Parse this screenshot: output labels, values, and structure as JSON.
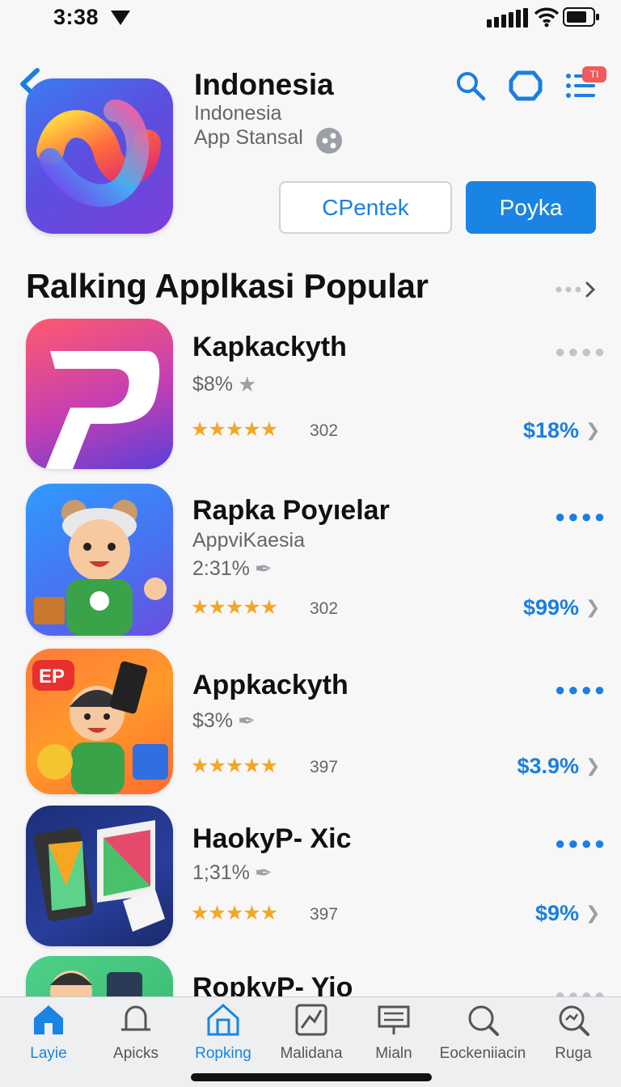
{
  "status": {
    "time": "3:38"
  },
  "header": {
    "title": "Indonesia",
    "subtitle1": "Indonesia",
    "subtitle2": "App Stansal",
    "badge": "TI",
    "btn_outline": "CPentek",
    "btn_primary": "Poyka"
  },
  "section": {
    "title": "Ralking Applkasi Popular"
  },
  "apps": [
    {
      "name": "Kapkackyth",
      "sub": "",
      "meta": "$8%",
      "meta_icon": "star-icon",
      "rating_count": "302",
      "price": "$18%",
      "stars": "★★★★★",
      "rating": 4.5,
      "dots_color": "#c0c4c8"
    },
    {
      "name": "Rapka Poyıelar",
      "sub": "AppviKaesia",
      "meta": "2:31%",
      "meta_icon": "feather-icon",
      "rating_count": "302",
      "price": "$99%",
      "stars": "★★★★★",
      "rating": 4.5,
      "dots_color": "#1a7fe0"
    },
    {
      "name": "Appkackyth",
      "sub": "",
      "meta": "$3%",
      "meta_icon": "feather-icon",
      "rating_count": "397",
      "price": "$3.9%",
      "stars": "★★★★★",
      "rating": 4.5,
      "dots_color": "#1a7fe0"
    },
    {
      "name": "HaokyP- Xic",
      "sub": "",
      "meta": "1;31%",
      "meta_icon": "feather-icon",
      "rating_count": "397",
      "price": "$9%",
      "stars": "★★★★★",
      "rating": 4.5,
      "dots_color": "#1a7fe0"
    },
    {
      "name": "RopkyP- Yio",
      "sub": "",
      "meta": "",
      "meta_icon": "",
      "rating_count": "",
      "price": "",
      "stars": "",
      "rating": 0,
      "dots_color": "#c0c4c8"
    }
  ],
  "tabs": [
    {
      "label": "Layie",
      "icon": "home-icon",
      "active": true
    },
    {
      "label": "Apicks",
      "icon": "bell-icon",
      "active": false
    },
    {
      "label": "Ropking",
      "icon": "house-outline-icon",
      "active": true
    },
    {
      "label": "Malidana",
      "icon": "chart-icon",
      "active": false
    },
    {
      "label": "Mialn",
      "icon": "board-icon",
      "active": false
    },
    {
      "label": "Eockeniiacin",
      "icon": "search-icon",
      "active": false
    },
    {
      "label": "Ruga",
      "icon": "search-zoom-icon",
      "active": false
    }
  ],
  "colors": {
    "accent": "#1a84e5",
    "star": "#f5a623"
  }
}
